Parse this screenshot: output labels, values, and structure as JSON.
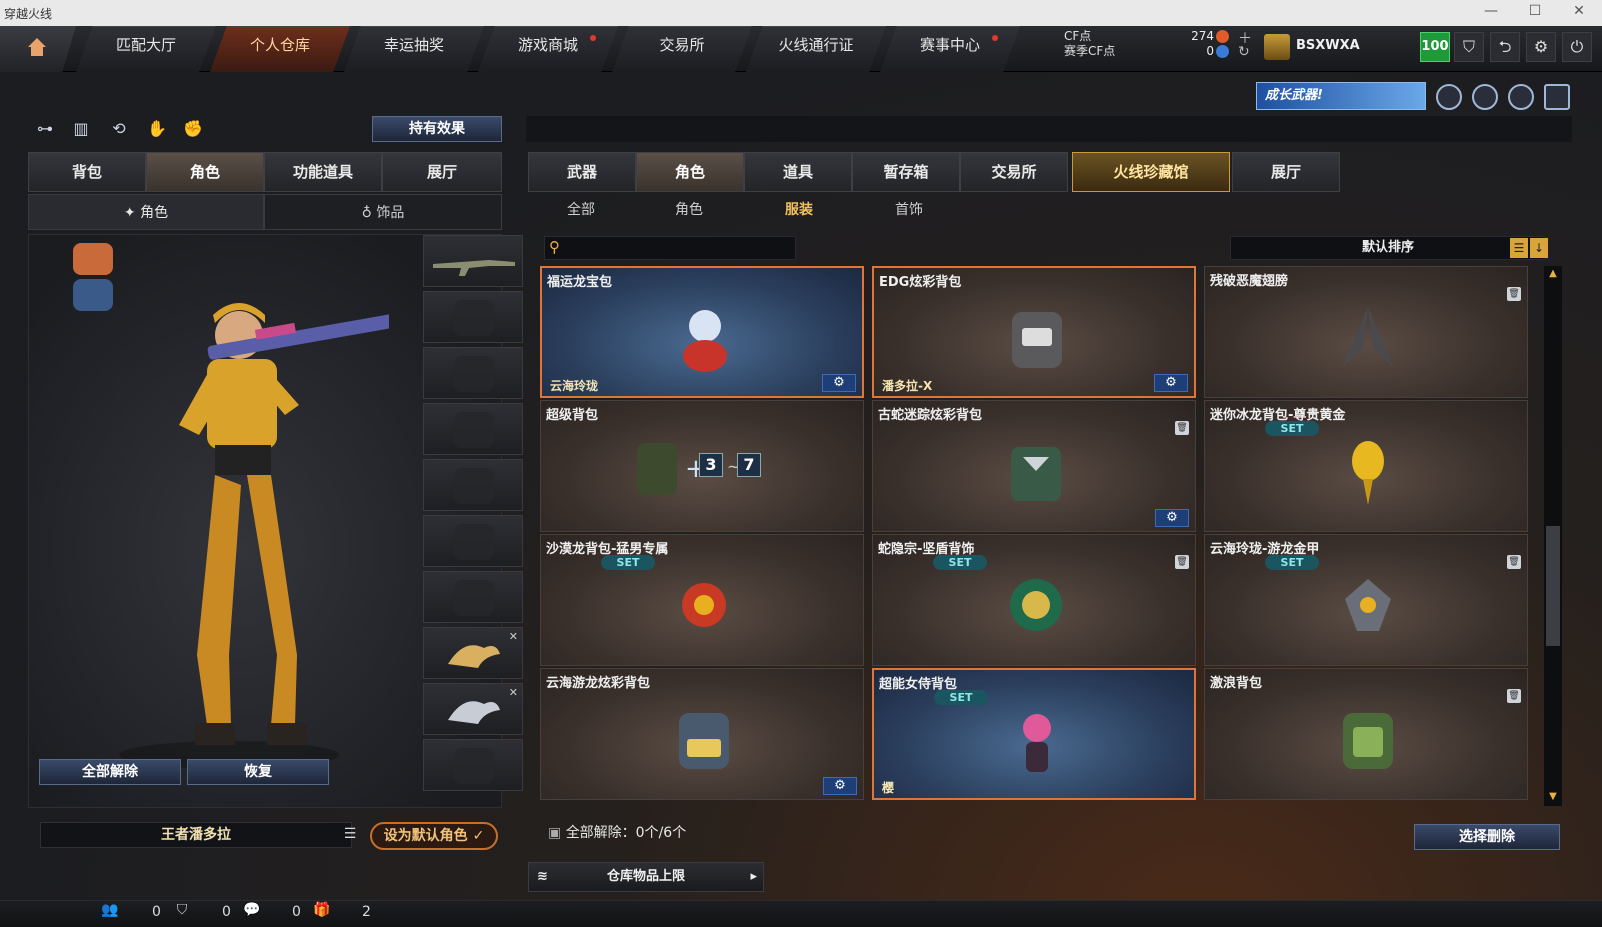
{
  "window": {
    "title": "穿越火线"
  },
  "nav": {
    "tabs": [
      {
        "label": "匹配大厅"
      },
      {
        "label": "个人仓库"
      },
      {
        "label": "幸运抽奖"
      },
      {
        "label": "游戏商城"
      },
      {
        "label": "交易所"
      },
      {
        "label": "火线通行证"
      },
      {
        "label": "赛事中心"
      }
    ],
    "cf_label": "CF点",
    "season_cf_label": "赛季CF点",
    "cf_value": "274",
    "season_cf_value": "0",
    "username": "BSXWXA",
    "level": "100"
  },
  "promo": {
    "text": "成长武器!"
  },
  "left": {
    "effects_button": "持有效果",
    "tabs": [
      {
        "label": "背包"
      },
      {
        "label": "角色"
      },
      {
        "label": "功能道具"
      },
      {
        "label": "展厅"
      }
    ],
    "subtabs": [
      {
        "label": "角色"
      },
      {
        "label": "饰品"
      }
    ],
    "unequip_all": "全部解除",
    "restore": "恢复",
    "character_name": "王者潘多拉",
    "set_default": "设为默认角色"
  },
  "right": {
    "tabs": [
      {
        "label": "武器"
      },
      {
        "label": "角色"
      },
      {
        "label": "道具"
      },
      {
        "label": "暂存箱"
      },
      {
        "label": "交易所"
      },
      {
        "label": "火线珍藏馆"
      },
      {
        "label": "展厅"
      }
    ],
    "subtabs": [
      {
        "label": "全部"
      },
      {
        "label": "角色"
      },
      {
        "label": "服装"
      },
      {
        "label": "首饰"
      }
    ],
    "sort_label": "默认排序",
    "items": [
      {
        "name": "福运龙宝包",
        "owner": "云海玲珑"
      },
      {
        "name": "EDG炫彩背包",
        "owner": "潘多拉-X"
      },
      {
        "name": "残破恶魔翅膀"
      },
      {
        "name": "超级背包",
        "tag1": "3",
        "tag2": "7"
      },
      {
        "name": "古蛇迷踪炫彩背包"
      },
      {
        "name": "迷你冰龙背包-尊贵黄金",
        "set": "SET"
      },
      {
        "name": "沙漠龙背包-猛男专属",
        "set": "SET"
      },
      {
        "name": "蛇隐宗-坚盾背饰",
        "set": "SET"
      },
      {
        "name": "云海玲珑-游龙金甲",
        "set": "SET"
      },
      {
        "name": "云海游龙炫彩背包"
      },
      {
        "name": "超能女侍背包",
        "set": "SET",
        "owner": "樱"
      },
      {
        "name": "激浪背包"
      }
    ],
    "unequip_status": "全部解除：0个/6个",
    "select_delete": "选择删除",
    "storage_limit": "仓库物品上限"
  },
  "status": {
    "count1": "0",
    "count2": "0",
    "count3": "0",
    "count4": "2"
  },
  "colors": {
    "accent": "#e0753a",
    "gold": "#f4c15a",
    "level_green": "#1e9a3a"
  }
}
